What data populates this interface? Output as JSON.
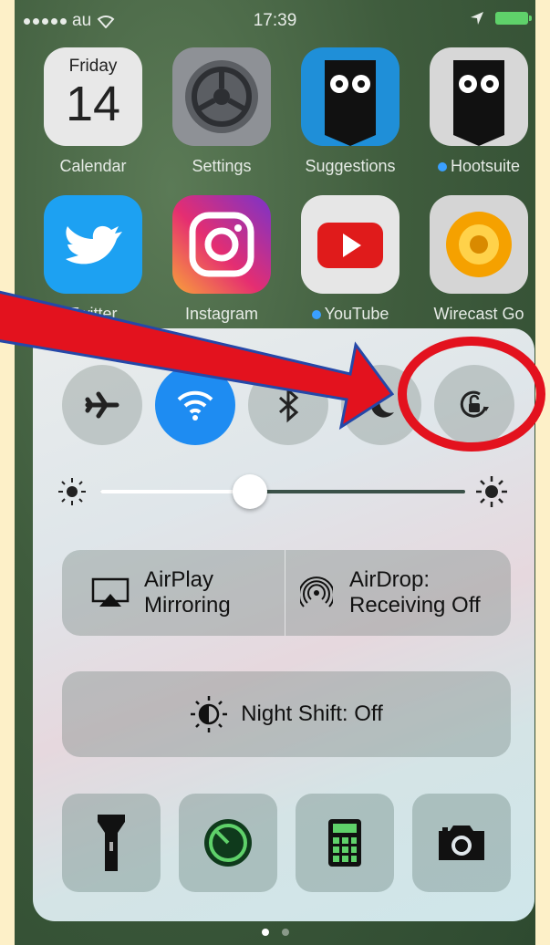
{
  "status_bar": {
    "carrier": "au",
    "time": "17:39"
  },
  "home_apps": [
    {
      "label": "Calendar",
      "day": "Friday",
      "date": "14"
    },
    {
      "label": "Settings"
    },
    {
      "label": "Suggestions"
    },
    {
      "label": "Hootsuite"
    },
    {
      "label": "Twitter"
    },
    {
      "label": "Instagram"
    },
    {
      "label": "YouTube"
    },
    {
      "label": "Wirecast Go"
    }
  ],
  "control_center": {
    "toggles": [
      "airplane-mode",
      "wifi",
      "bluetooth",
      "do-not-disturb",
      "rotation-lock"
    ],
    "airplay": {
      "line1": "AirPlay",
      "line2": "Mirroring"
    },
    "airdrop": {
      "line1": "AirDrop:",
      "line2": "Receiving Off"
    },
    "night_shift": "Night Shift: Off",
    "brightness": 0.41,
    "shortcuts": [
      "flashlight",
      "timer",
      "calculator",
      "camera"
    ]
  },
  "colors": {
    "accent": "#1e8cf2",
    "annotation": "#e3121e",
    "arrow_outline": "#2548a8"
  }
}
